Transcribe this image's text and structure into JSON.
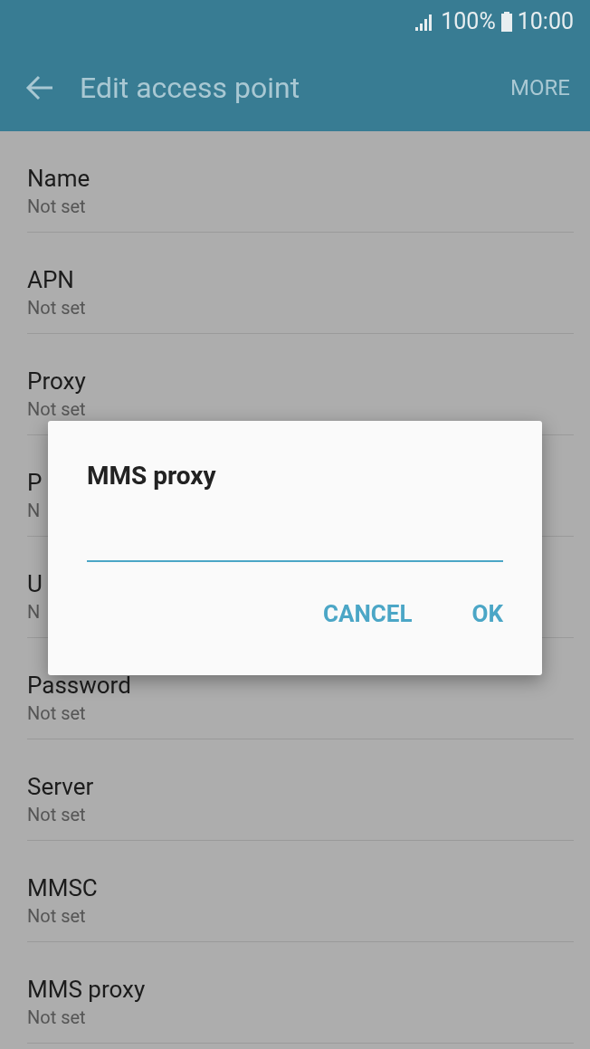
{
  "status_bar": {
    "battery": "100%",
    "time": "10:00"
  },
  "app_bar": {
    "title": "Edit access point",
    "action": "MORE"
  },
  "settings": [
    {
      "title": "Name",
      "value": "Not set"
    },
    {
      "title": "APN",
      "value": "Not set"
    },
    {
      "title": "Proxy",
      "value": "Not set"
    },
    {
      "title": "P",
      "value": "N"
    },
    {
      "title": "U",
      "value": "N"
    },
    {
      "title": "Password",
      "value": "Not set"
    },
    {
      "title": "Server",
      "value": "Not set"
    },
    {
      "title": "MMSC",
      "value": "Not set"
    },
    {
      "title": "MMS proxy",
      "value": "Not set"
    }
  ],
  "dialog": {
    "title": "MMS proxy",
    "buttons": [
      "CANCEL",
      "OK"
    ]
  }
}
